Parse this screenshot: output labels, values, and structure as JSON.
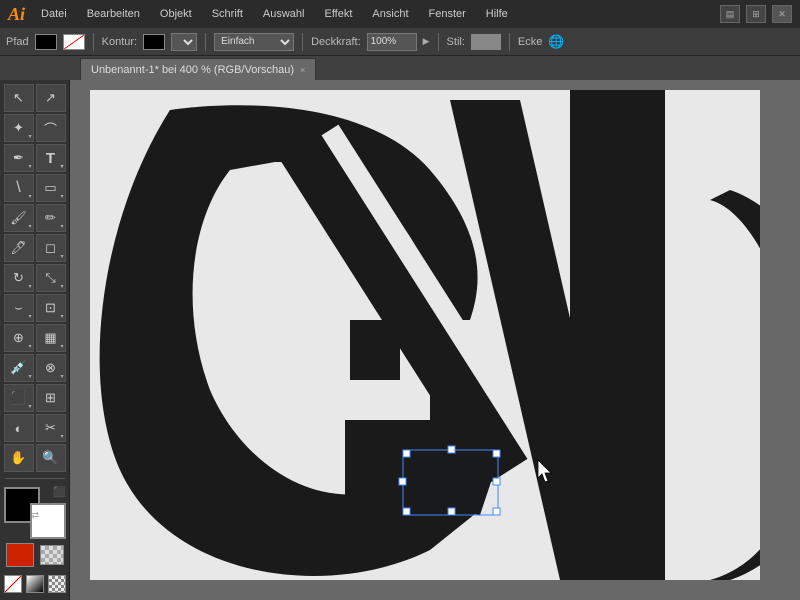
{
  "app": {
    "logo": "Ai",
    "menus": [
      "Datei",
      "Bearbeiten",
      "Objekt",
      "Schrift",
      "Auswahl",
      "Effekt",
      "Ansicht",
      "Fenster",
      "Hilfe"
    ]
  },
  "optionsbar": {
    "path_label": "Pfad",
    "fill_label": "",
    "kontur_label": "Kontur:",
    "stroke_style": "Einfach",
    "deckkraft_label": "Deckkraft:",
    "deckkraft_value": "100%",
    "stil_label": "Stil:",
    "ecke_label": "Ecke"
  },
  "tab": {
    "title": "Unbenannt-1* bei 400 % (RGB/Vorschau)",
    "close": "×"
  },
  "tools": [
    {
      "name": "selection",
      "icon": "↖",
      "has_arrow": false
    },
    {
      "name": "direct-selection",
      "icon": "↗",
      "has_arrow": false
    },
    {
      "name": "magic-wand",
      "icon": "✦",
      "has_arrow": true
    },
    {
      "name": "lasso",
      "icon": "⌒",
      "has_arrow": false
    },
    {
      "name": "pen",
      "icon": "✒",
      "has_arrow": true
    },
    {
      "name": "type",
      "icon": "T",
      "has_arrow": true
    },
    {
      "name": "line",
      "icon": "\\",
      "has_arrow": true
    },
    {
      "name": "shape",
      "icon": "▭",
      "has_arrow": true
    },
    {
      "name": "brush",
      "icon": "🖌",
      "has_arrow": true
    },
    {
      "name": "pencil",
      "icon": "✏",
      "has_arrow": true
    },
    {
      "name": "blob-brush",
      "icon": "🖊",
      "has_arrow": false
    },
    {
      "name": "eraser",
      "icon": "◻",
      "has_arrow": true
    },
    {
      "name": "rotate",
      "icon": "↻",
      "has_arrow": true
    },
    {
      "name": "scale",
      "icon": "⤡",
      "has_arrow": true
    },
    {
      "name": "warp",
      "icon": "⌣",
      "has_arrow": true
    },
    {
      "name": "graph",
      "icon": "📊",
      "has_arrow": true
    },
    {
      "name": "symbol",
      "icon": "⊕",
      "has_arrow": true
    },
    {
      "name": "column-graph",
      "icon": "▦",
      "has_arrow": true
    },
    {
      "name": "eyedropper",
      "icon": "💉",
      "has_arrow": true
    },
    {
      "name": "blend",
      "icon": "⊗",
      "has_arrow": true
    },
    {
      "name": "live-paint",
      "icon": "⬛",
      "has_arrow": true
    },
    {
      "name": "mesh",
      "icon": "⊞",
      "has_arrow": false
    },
    {
      "name": "gradient",
      "icon": "◐",
      "has_arrow": false
    },
    {
      "name": "scissors",
      "icon": "✂",
      "has_arrow": true
    },
    {
      "name": "hand",
      "icon": "✋",
      "has_arrow": false
    },
    {
      "name": "zoom",
      "icon": "🔍",
      "has_arrow": false
    }
  ],
  "colors": {
    "fg": "#000000",
    "bg": "#ffffff",
    "accent": "#ff3300"
  }
}
